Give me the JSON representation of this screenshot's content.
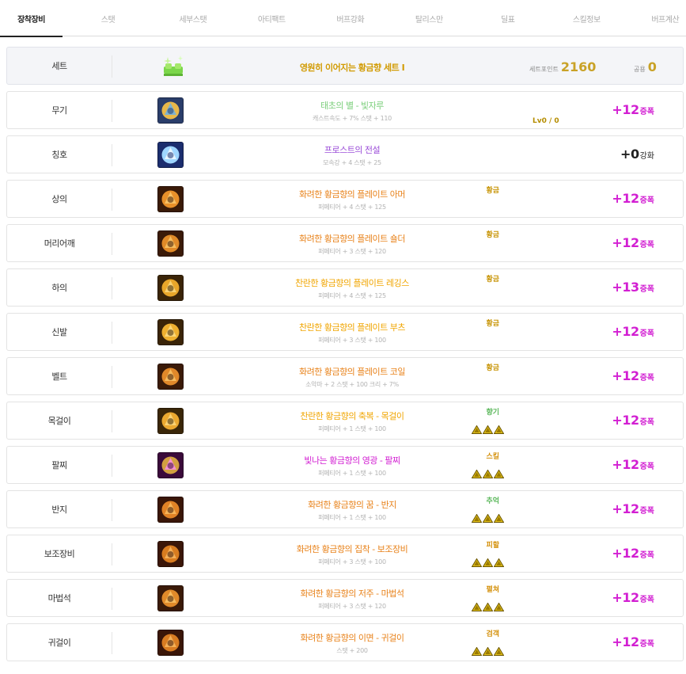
{
  "tabs": [
    "장착장비",
    "스탯",
    "세부스탯",
    "아티팩트",
    "버프강화",
    "탈리스만",
    "딜표",
    "스킬정보",
    "버프계산"
  ],
  "set_row": {
    "slot": "세트",
    "name": "영원히 이어지는 황금향 세트 I",
    "setpoint_label": "세트포인트",
    "setpoint_value": "2160",
    "common_label": "공용",
    "common_value": "0"
  },
  "rows": [
    {
      "slot": "무기",
      "name": "태초의 별 - 빛자루",
      "name_color": "#7ccf7c",
      "stat": "캐스트속도 + 7% 스탯 + 110",
      "emblem": "",
      "lv": "Lv0 / 0",
      "plus": "+12",
      "unit": "증폭",
      "plain": false,
      "triangles": false,
      "icon": "weapon-icon"
    },
    {
      "slot": "칭호",
      "name": "프로스트의 전설",
      "name_color": "#9b4ed8",
      "stat": "모속강 + 4 스탯 + 25",
      "emblem": "",
      "lv": "",
      "plus": "+0",
      "unit": "강화",
      "plain": true,
      "triangles": false,
      "icon": "title-icon"
    },
    {
      "slot": "상의",
      "name": "화려한 황금향의 플레이트 아머",
      "name_color": "#e8821a",
      "stat": "퍼페티어 + 4 스탯 + 125",
      "emblem": "황금",
      "lv": "",
      "plus": "+12",
      "unit": "증폭",
      "plain": false,
      "triangles": false,
      "icon": "armor-icon"
    },
    {
      "slot": "머리어깨",
      "name": "화려한 황금향의 플레이트 숄더",
      "name_color": "#e8821a",
      "stat": "퍼페티어 + 3 스탯 + 120",
      "emblem": "황금",
      "lv": "",
      "plus": "+12",
      "unit": "증폭",
      "plain": false,
      "triangles": false,
      "icon": "shoulder-icon"
    },
    {
      "slot": "하의",
      "name": "찬란한 황금향의 플레이트 레깅스",
      "name_color": "#f0a500",
      "stat": "퍼페티어 + 4 스탯 + 125",
      "emblem": "황금",
      "lv": "",
      "plus": "+13",
      "unit": "증폭",
      "plain": false,
      "triangles": false,
      "icon": "leggings-icon"
    },
    {
      "slot": "신발",
      "name": "찬란한 황금향의 플레이트 부츠",
      "name_color": "#f0a500",
      "stat": "퍼페티어 + 3 스탯 + 100",
      "emblem": "황금",
      "lv": "",
      "plus": "+12",
      "unit": "증폭",
      "plain": false,
      "triangles": false,
      "icon": "boots-icon"
    },
    {
      "slot": "벨트",
      "name": "화려한 황금향의 플레이트 코일",
      "name_color": "#e8821a",
      "stat": "소악마 + 2 스탯 + 100 크리 + 7%",
      "emblem": "황금",
      "lv": "",
      "plus": "+12",
      "unit": "증폭",
      "plain": false,
      "triangles": false,
      "icon": "belt-icon"
    },
    {
      "slot": "목걸이",
      "name": "찬란한 황금향의 축복 - 목걸이",
      "name_color": "#f0a500",
      "stat": "퍼페티어 + 1 스탯 + 100",
      "emblem": "향기",
      "lv": "",
      "plus": "+12",
      "unit": "증폭",
      "plain": false,
      "triangles": true,
      "icon": "necklace-icon"
    },
    {
      "slot": "팔찌",
      "name": "빛나는 황금향의 영광 - 팔찌",
      "name_color": "#d21fd2",
      "stat": "퍼페티어 + 1 스탯 + 100",
      "emblem": "스킬",
      "lv": "",
      "plus": "+12",
      "unit": "증폭",
      "plain": false,
      "triangles": true,
      "icon": "bracelet-icon"
    },
    {
      "slot": "반지",
      "name": "화려한 황금향의 꿈 - 반지",
      "name_color": "#e8821a",
      "stat": "퍼페티어 + 1 스탯 + 100",
      "emblem": "추억",
      "lv": "",
      "plus": "+12",
      "unit": "증폭",
      "plain": false,
      "triangles": true,
      "icon": "ring-icon"
    },
    {
      "slot": "보조장비",
      "name": "화려한 황금향의 집착 - 보조장비",
      "name_color": "#e8821a",
      "stat": "퍼페티어 + 3 스탯 + 100",
      "emblem": "피할",
      "lv": "",
      "plus": "+12",
      "unit": "증폭",
      "plain": false,
      "triangles": true,
      "icon": "subweapon-icon"
    },
    {
      "slot": "마법석",
      "name": "화려한 황금향의 저주 - 마법석",
      "name_color": "#e8821a",
      "stat": "퍼페티어 + 3 스탯 + 120",
      "emblem": "펼쳐",
      "lv": "",
      "plus": "+12",
      "unit": "증폭",
      "plain": false,
      "triangles": true,
      "icon": "magicstone-icon"
    },
    {
      "slot": "귀걸이",
      "name": "화려한 황금향의 이면 - 귀걸이",
      "name_color": "#e8821a",
      "stat": "스탯 + 200",
      "emblem": "검객",
      "lv": "",
      "plus": "+12",
      "unit": "증폭",
      "plain": false,
      "triangles": true,
      "icon": "earring-icon"
    }
  ],
  "colors": {
    "accent": "#d21fd2",
    "gold": "#c9a227",
    "emblem": "#c69200",
    "green_emblem": "#5cb85c"
  }
}
